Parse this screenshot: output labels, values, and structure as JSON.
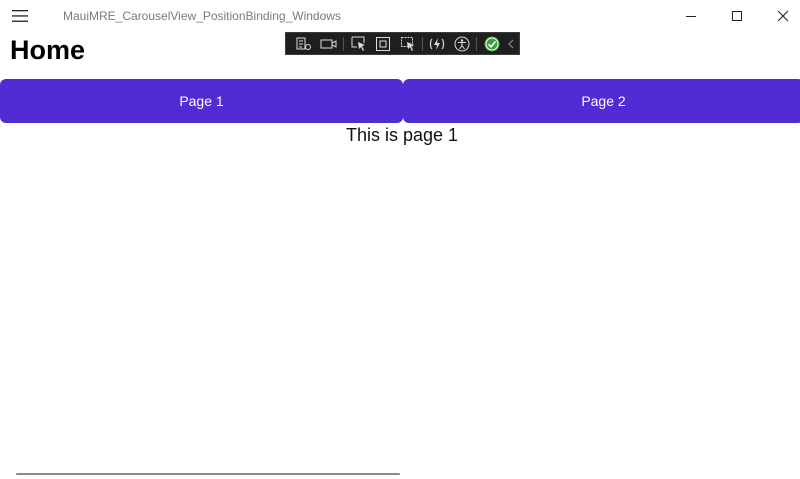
{
  "window": {
    "title": "MauiMRE_CarouselView_PositionBinding_Windows",
    "menu_icon": "hamburger-icon",
    "controls": [
      "minimize-icon",
      "maximize-icon",
      "close-icon"
    ]
  },
  "debug_toolbar": {
    "icons": [
      "live-visual-tree-icon",
      "video-camera-icon",
      "select-element-icon",
      "display-adorners-icon",
      "track-focus-icon",
      "hot-reload-icon",
      "accessibility-icon",
      "checkmark-icon",
      "chevron-left-icon"
    ],
    "check_color": "#3ba13b"
  },
  "page": {
    "title": "Home"
  },
  "tabs": [
    {
      "label": "Page 1"
    },
    {
      "label": "Page 2"
    }
  ],
  "carousel": {
    "current_text": "This is page 1"
  },
  "colors": {
    "accent": "#512bd4",
    "toolbar_bg": "#1f1f1f"
  }
}
